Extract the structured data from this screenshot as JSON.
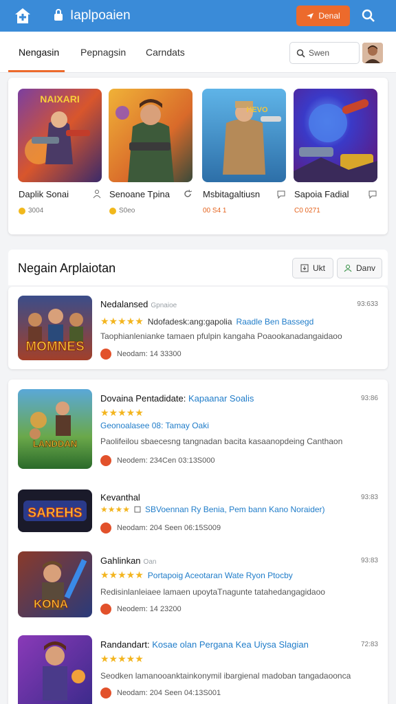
{
  "header": {
    "title": "Iaplpoaien",
    "action_label": "Denal",
    "icons": [
      "home-icon",
      "lock-icon",
      "search-icon"
    ],
    "colors": {
      "bar": "#3a8bd8",
      "accent": "#ec6a2c"
    }
  },
  "tabs": [
    {
      "label": "Nengasin",
      "active": true
    },
    {
      "label": "Pepnagsin",
      "active": false
    },
    {
      "label": "Carndats",
      "active": false
    }
  ],
  "search": {
    "placeholder": "Swen"
  },
  "featured": [
    {
      "name": "Daplik Sonai",
      "price": "3004",
      "thumb_text": "NAIXARI"
    },
    {
      "name": "Senoane Tpina",
      "price": "S0eo",
      "thumb_text": ""
    },
    {
      "name": "Msbitagaltiusn",
      "price": "00 S4 1",
      "thumb_text": "HEVO"
    },
    {
      "name": "Sapoia Fadial",
      "price": "C0 0271",
      "thumb_text": ""
    }
  ],
  "new_apps": {
    "title": "Negain Arplaiotan",
    "btn1": "Ukt",
    "btn2": "Danv"
  },
  "items": [
    {
      "name": "Nedalansed",
      "tag": "Gpnaioe",
      "time": "93:633",
      "subtitle": "Ndofadesk:ang:gapolia",
      "subtitle_blue": "Raadle Ben Bassegd",
      "desc": "Taophianlenianke tamaen pfulpin kangaha Poaookanadangaidaoo",
      "meta": "Neodam: 14 33300",
      "thumb_text": "MOMNES"
    },
    {
      "name": "Dovaina Pentadidate:",
      "name_blue": "Kapaanar Soalis",
      "time": "93:86",
      "subtitle": "",
      "subtitle_blue": "Geonoalasee 08: Tamay Oaki",
      "desc": "Paolifeilou sbaecesng tangnadan bacita kasaanopdeing Canthaon",
      "meta": "Neodem: 234Cen 03:13S000",
      "thumb_text": "LANDDAN"
    },
    {
      "name": "Kevanthal",
      "time": "93:83",
      "subtitle": "",
      "subtitle_blue": "SBVoennan Ry Benia, Pem bann Kano Noraider)",
      "desc": "",
      "meta": "Neodam: 204 Seen 06:15S009",
      "thumb_text": "SAREHS"
    },
    {
      "name": "Gahlinkan",
      "tag": "Oan",
      "time": "93:83",
      "subtitle": "",
      "subtitle_blue": "Portapoig Aceotaran Wate Ryon Ptocby",
      "desc": "Redisinlanleiaee lamaen upoytaTnagunte tatahedangagidaoo",
      "meta": "Neodem: 14 23200",
      "thumb_text": "KONA"
    },
    {
      "name": "Randandart:",
      "name_blue": "Kosae olan Pergana Kea Uiysa Slagian",
      "time": "72:83",
      "subtitle": "",
      "subtitle_blue": "",
      "desc": "Seodken lamanooanktainkonymil ibargienal madoban tangadaoonca",
      "meta": "Neodam: 204 Seen 04:13S001",
      "thumb_text": ""
    }
  ]
}
